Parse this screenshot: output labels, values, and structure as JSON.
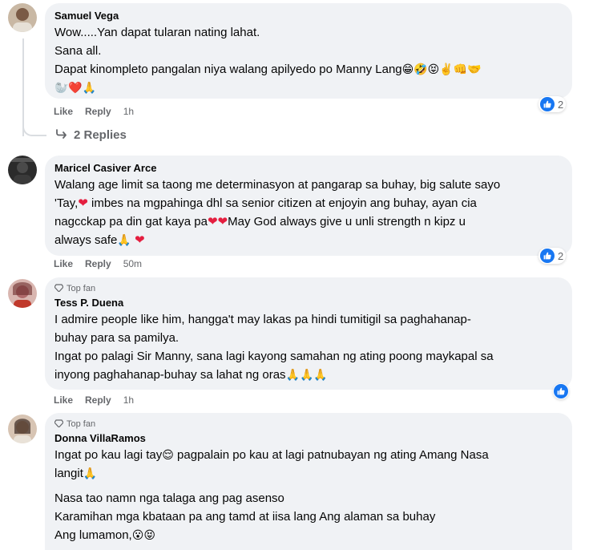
{
  "comments": [
    {
      "name": "Samuel Vega",
      "badge": "",
      "lines": [
        "Wow.....Yan dapat tularan nating lahat.",
        "Sana all.",
        "Dapat kinompleto pangalan niya walang apilyedo po Manny Lang"
      ],
      "emoji_tail_1": "😁🤣😝✌️👊🤝",
      "emoji_tail_2": "🦭❤️🙏",
      "like": "Like",
      "reply": "Reply",
      "time": "1h",
      "reaction_count": "2",
      "replies_label": "2 Replies"
    },
    {
      "name": "Maricel Casiver Arce",
      "badge": "",
      "line1": "Walang age limit sa taong me determinasyon at pangarap sa buhay, big salute sayo",
      "line2a": "'Tay,",
      "line2b": " imbes na mgpahinga dhl sa senior citizen at enjoyin ang buhay, ayan cia",
      "line3a": "nagcckap pa din gat kaya pa",
      "line3b": "May God always give u unli strength n kipz u",
      "line4a": "always safe",
      "like": "Like",
      "reply": "Reply",
      "time": "50m",
      "reaction_count": "2"
    },
    {
      "name": "Tess P. Duena",
      "badge": "Top fan",
      "lines": [
        "I admire people like him, hangga't may lakas pa hindi tumitigil sa paghahanap-",
        "buhay para sa pamilya.",
        "Ingat po palagi Sir Manny, sana lagi kayong samahan ng ating poong maykapal sa",
        "inyong paghahanap-buhay sa lahat ng oras"
      ],
      "emoji_tail": "🙏🙏🙏",
      "like": "Like",
      "reply": "Reply",
      "time": "1h"
    },
    {
      "name": "Donna VillaRamos",
      "badge": "Top fan",
      "line1a": "Ingat po kau lagi tay",
      "line1b": " pagpalain po kau at lagi patnubayan ng ating Amang Nasa",
      "line2": "langit",
      "line3": "Nasa tao namn nga talaga ang pag asenso",
      "line4": "Karamihan mga kbataan pa ang tamd at iisa lang Ang alaman sa buhay",
      "line5": "Ang lumamon,",
      "emoji_1": "😌",
      "emoji_5": "😮😝"
    }
  ],
  "colors": {
    "bubble": "#f0f2f5",
    "like_blue": "#1877f2",
    "meta": "#65676b",
    "heart": "#e41e3f"
  }
}
